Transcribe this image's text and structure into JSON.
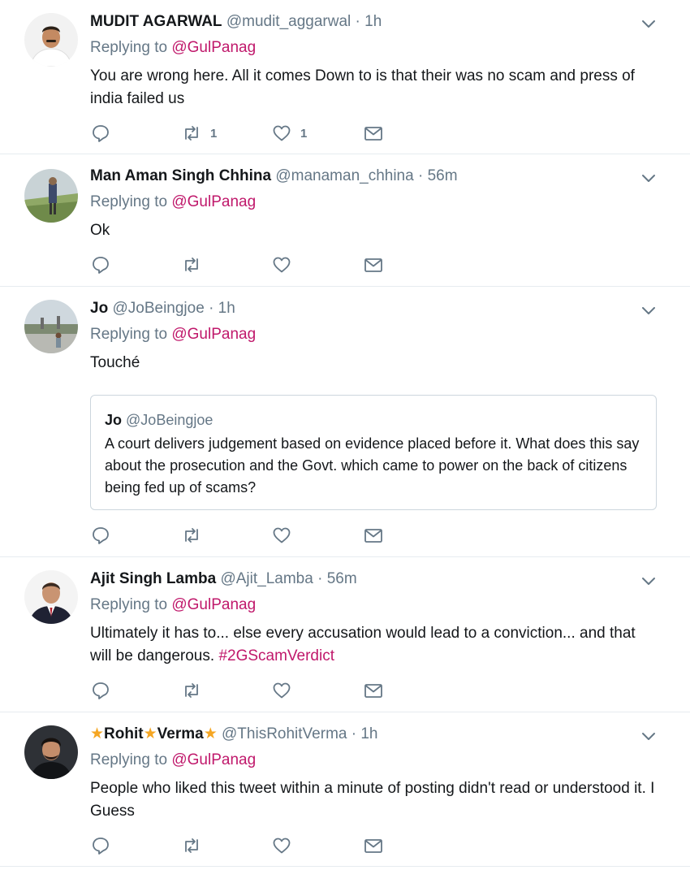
{
  "tweets": [
    {
      "name": "MUDIT AGARWAL",
      "handle": "@mudit_aggarwal",
      "dot": "·",
      "time": "1h",
      "replying_prefix": "Replying to ",
      "replying_to": "@GulPanag",
      "text": "You are wrong here. All it comes Down to is that their was no scam and press of india failed us",
      "retweets": "1",
      "likes": "1"
    },
    {
      "name": "Man Aman Singh Chhina",
      "handle": "@manaman_chhina",
      "dot": "·",
      "time": "56m",
      "replying_prefix": "Replying to ",
      "replying_to": "@GulPanag",
      "text": "Ok",
      "retweets": "",
      "likes": ""
    },
    {
      "name": "Jo",
      "handle": "@JoBeingjoe",
      "dot": "·",
      "time": "1h",
      "replying_prefix": "Replying to ",
      "replying_to": "@GulPanag",
      "text": "Touché",
      "quote": {
        "name": "Jo",
        "handle": "@JoBeingjoe",
        "text": "A court delivers judgement based  on evidence placed before it. What does this say about the prosecution and the Govt. which came to power on the back of citizens being fed up of scams?"
      },
      "retweets": "",
      "likes": ""
    },
    {
      "name": "Ajit Singh Lamba",
      "handle": "@Ajit_Lamba",
      "dot": "·",
      "time": "56m",
      "replying_prefix": "Replying to ",
      "replying_to": "@GulPanag",
      "text": "Ultimately it has to... else every accusation would lead to a conviction... and that will be dangerous. ",
      "hashtag": "#2GScamVerdict",
      "retweets": "",
      "likes": ""
    },
    {
      "name_star": "★",
      "name_part1": "Rohit",
      "name_part2": "Verma",
      "handle": "@ThisRohitVerma",
      "dot": "·",
      "time": "1h",
      "replying_prefix": "Replying to ",
      "replying_to": "@GulPanag",
      "text": "People who liked this tweet within a minute of posting didn't read or understood it.  I Guess",
      "retweets": "",
      "likes": ""
    }
  ],
  "icons": {
    "reply": "reply-icon",
    "retweet": "retweet-icon",
    "like": "heart-icon",
    "message": "envelope-icon",
    "caret": "chevron-down-icon"
  },
  "colors": {
    "link": "#c0186b",
    "muted": "#657786",
    "star": "#f5a623",
    "divider": "#e6ecf0"
  }
}
